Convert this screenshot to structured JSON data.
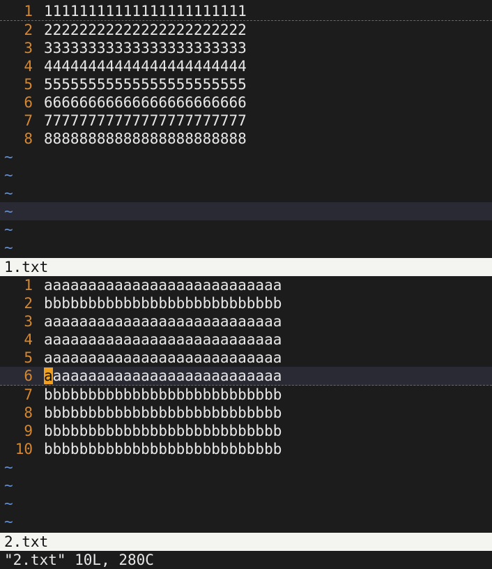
{
  "colors": {
    "background": "#1c1c1c",
    "line_number": "#d7872f",
    "tilde": "#5f8fd7",
    "status_bg": "#f4f4f0",
    "cursor": "#f0a020"
  },
  "top_window": {
    "filename": "1.txt",
    "lines": [
      {
        "num": "1",
        "text": "11111111111111111111111"
      },
      {
        "num": "2",
        "text": "22222222222222222222222"
      },
      {
        "num": "3",
        "text": "33333333333333333333333"
      },
      {
        "num": "4",
        "text": "44444444444444444444444"
      },
      {
        "num": "5",
        "text": "55555555555555555555555"
      },
      {
        "num": "6",
        "text": "66666666666666666666666"
      },
      {
        "num": "7",
        "text": "77777777777777777777777"
      },
      {
        "num": "8",
        "text": "88888888888888888888888"
      }
    ],
    "tilde": "~"
  },
  "bottom_window": {
    "filename": "2.txt",
    "lines": [
      {
        "num": "1",
        "text": "aaaaaaaaaaaaaaaaaaaaaaaaaaa"
      },
      {
        "num": "2",
        "text": "bbbbbbbbbbbbbbbbbbbbbbbbbbb"
      },
      {
        "num": "3",
        "text": "aaaaaaaaaaaaaaaaaaaaaaaaaaa"
      },
      {
        "num": "4",
        "text": "aaaaaaaaaaaaaaaaaaaaaaaaaaa"
      },
      {
        "num": "5",
        "text": "aaaaaaaaaaaaaaaaaaaaaaaaaaa"
      },
      {
        "num": "6",
        "cursor_char": "a",
        "text_rest": "aaaaaaaaaaaaaaaaaaaaaaaaaa"
      },
      {
        "num": "7",
        "text": "bbbbbbbbbbbbbbbbbbbbbbbbbbb"
      },
      {
        "num": "8",
        "text": "bbbbbbbbbbbbbbbbbbbbbbbbbbb"
      },
      {
        "num": "9",
        "text": "bbbbbbbbbbbbbbbbbbbbbbbbbbb"
      },
      {
        "num": "10",
        "text": "bbbbbbbbbbbbbbbbbbbbbbbbbbb"
      }
    ],
    "tilde": "~"
  },
  "message_line": "\"2.txt\" 10L, 280C"
}
